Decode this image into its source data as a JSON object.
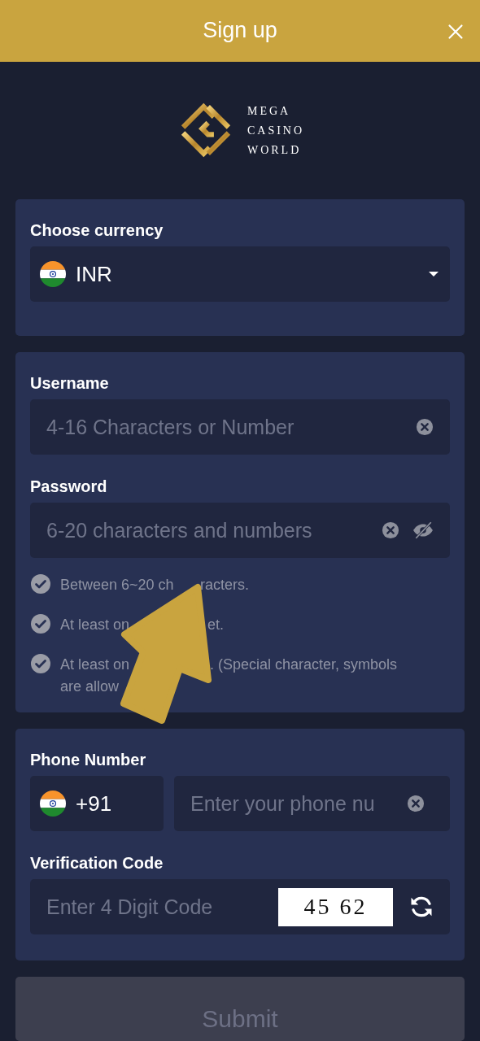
{
  "header": {
    "title": "Sign up"
  },
  "logo": {
    "lines": [
      "MEGA",
      "CASINO",
      "WORLD"
    ]
  },
  "currency": {
    "label": "Choose currency",
    "value": "INR"
  },
  "username": {
    "label": "Username",
    "placeholder": "4-16 Characters or Number"
  },
  "password": {
    "label": "Password",
    "placeholder": "6-20 characters and numbers"
  },
  "password_rules": [
    {
      "met": false,
      "lines": [
        [
          "Between 6~20 ch",
          "racters."
        ]
      ]
    },
    {
      "met": false,
      "lines": [
        [
          "At least on",
          "et."
        ]
      ]
    },
    {
      "met": false,
      "lines": [
        [
          "At least on",
          ". (Special character, symbols"
        ],
        [
          "are allow"
        ]
      ]
    }
  ],
  "phone": {
    "label": "Phone Number",
    "country_code": "+91",
    "placeholder": "Enter your phone nu"
  },
  "verification": {
    "label": "Verification Code",
    "placeholder": "Enter 4 Digit Code",
    "captcha": "45 62"
  },
  "submit": {
    "label": "Submit",
    "disabled": true
  }
}
